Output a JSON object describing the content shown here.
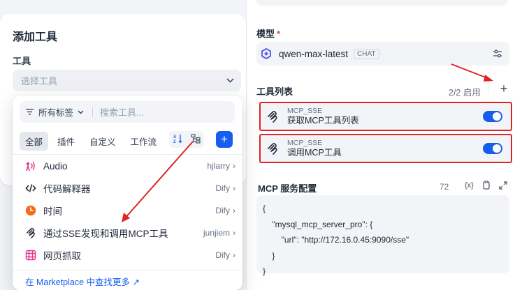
{
  "add_panel": {
    "title": "添加工具",
    "tool_label": "工具",
    "select_placeholder": "选择工具"
  },
  "dropdown": {
    "tag_filter": "所有标签",
    "search_placeholder": "搜索工具...",
    "tabs": [
      "全部",
      "插件",
      "自定义",
      "工作流"
    ],
    "active_tab": "全部",
    "items": [
      {
        "name": "Audio",
        "author": "hjlarry",
        "icon": "audio-icon"
      },
      {
        "name": "代码解释器",
        "author": "Dify",
        "icon": "code-icon"
      },
      {
        "name": "时间",
        "author": "Dify",
        "icon": "clock-icon"
      },
      {
        "name": "通过SSE发现和调用MCP工具",
        "author": "junjiem",
        "icon": "mcp-icon"
      },
      {
        "name": "网页抓取",
        "author": "Dify",
        "icon": "web-scraper-icon"
      }
    ],
    "footer_link": "在 Marketplace 中查找更多 ↗"
  },
  "config": {
    "model_label": "模型",
    "required_mark": "*",
    "model_name": "qwen-max-latest",
    "model_mode": "CHAT",
    "tools_label": "工具列表",
    "tools_count": "2/2 启用",
    "add_symbol": "+",
    "tools": [
      {
        "provider": "MCP_SSE",
        "name": "获取MCP工具列表",
        "enabled": true
      },
      {
        "provider": "MCP_SSE",
        "name": "调用MCP工具",
        "enabled": true
      }
    ],
    "mcp_label": "MCP 服务配置",
    "mcp_length": "72",
    "mcp_var_symbol": "{x}",
    "mcp_code": "{\n    \"mysql_mcp_server_pro\": {\n        \"url\": \"http://172.16.0.45:9090/sse\"\n    }\n}"
  },
  "colors": {
    "accent": "#155eef",
    "annotation": "#e02424",
    "audio_icon": "#e4398b",
    "clock_icon": "#f26b1d",
    "web_icon": "#e4398b"
  }
}
